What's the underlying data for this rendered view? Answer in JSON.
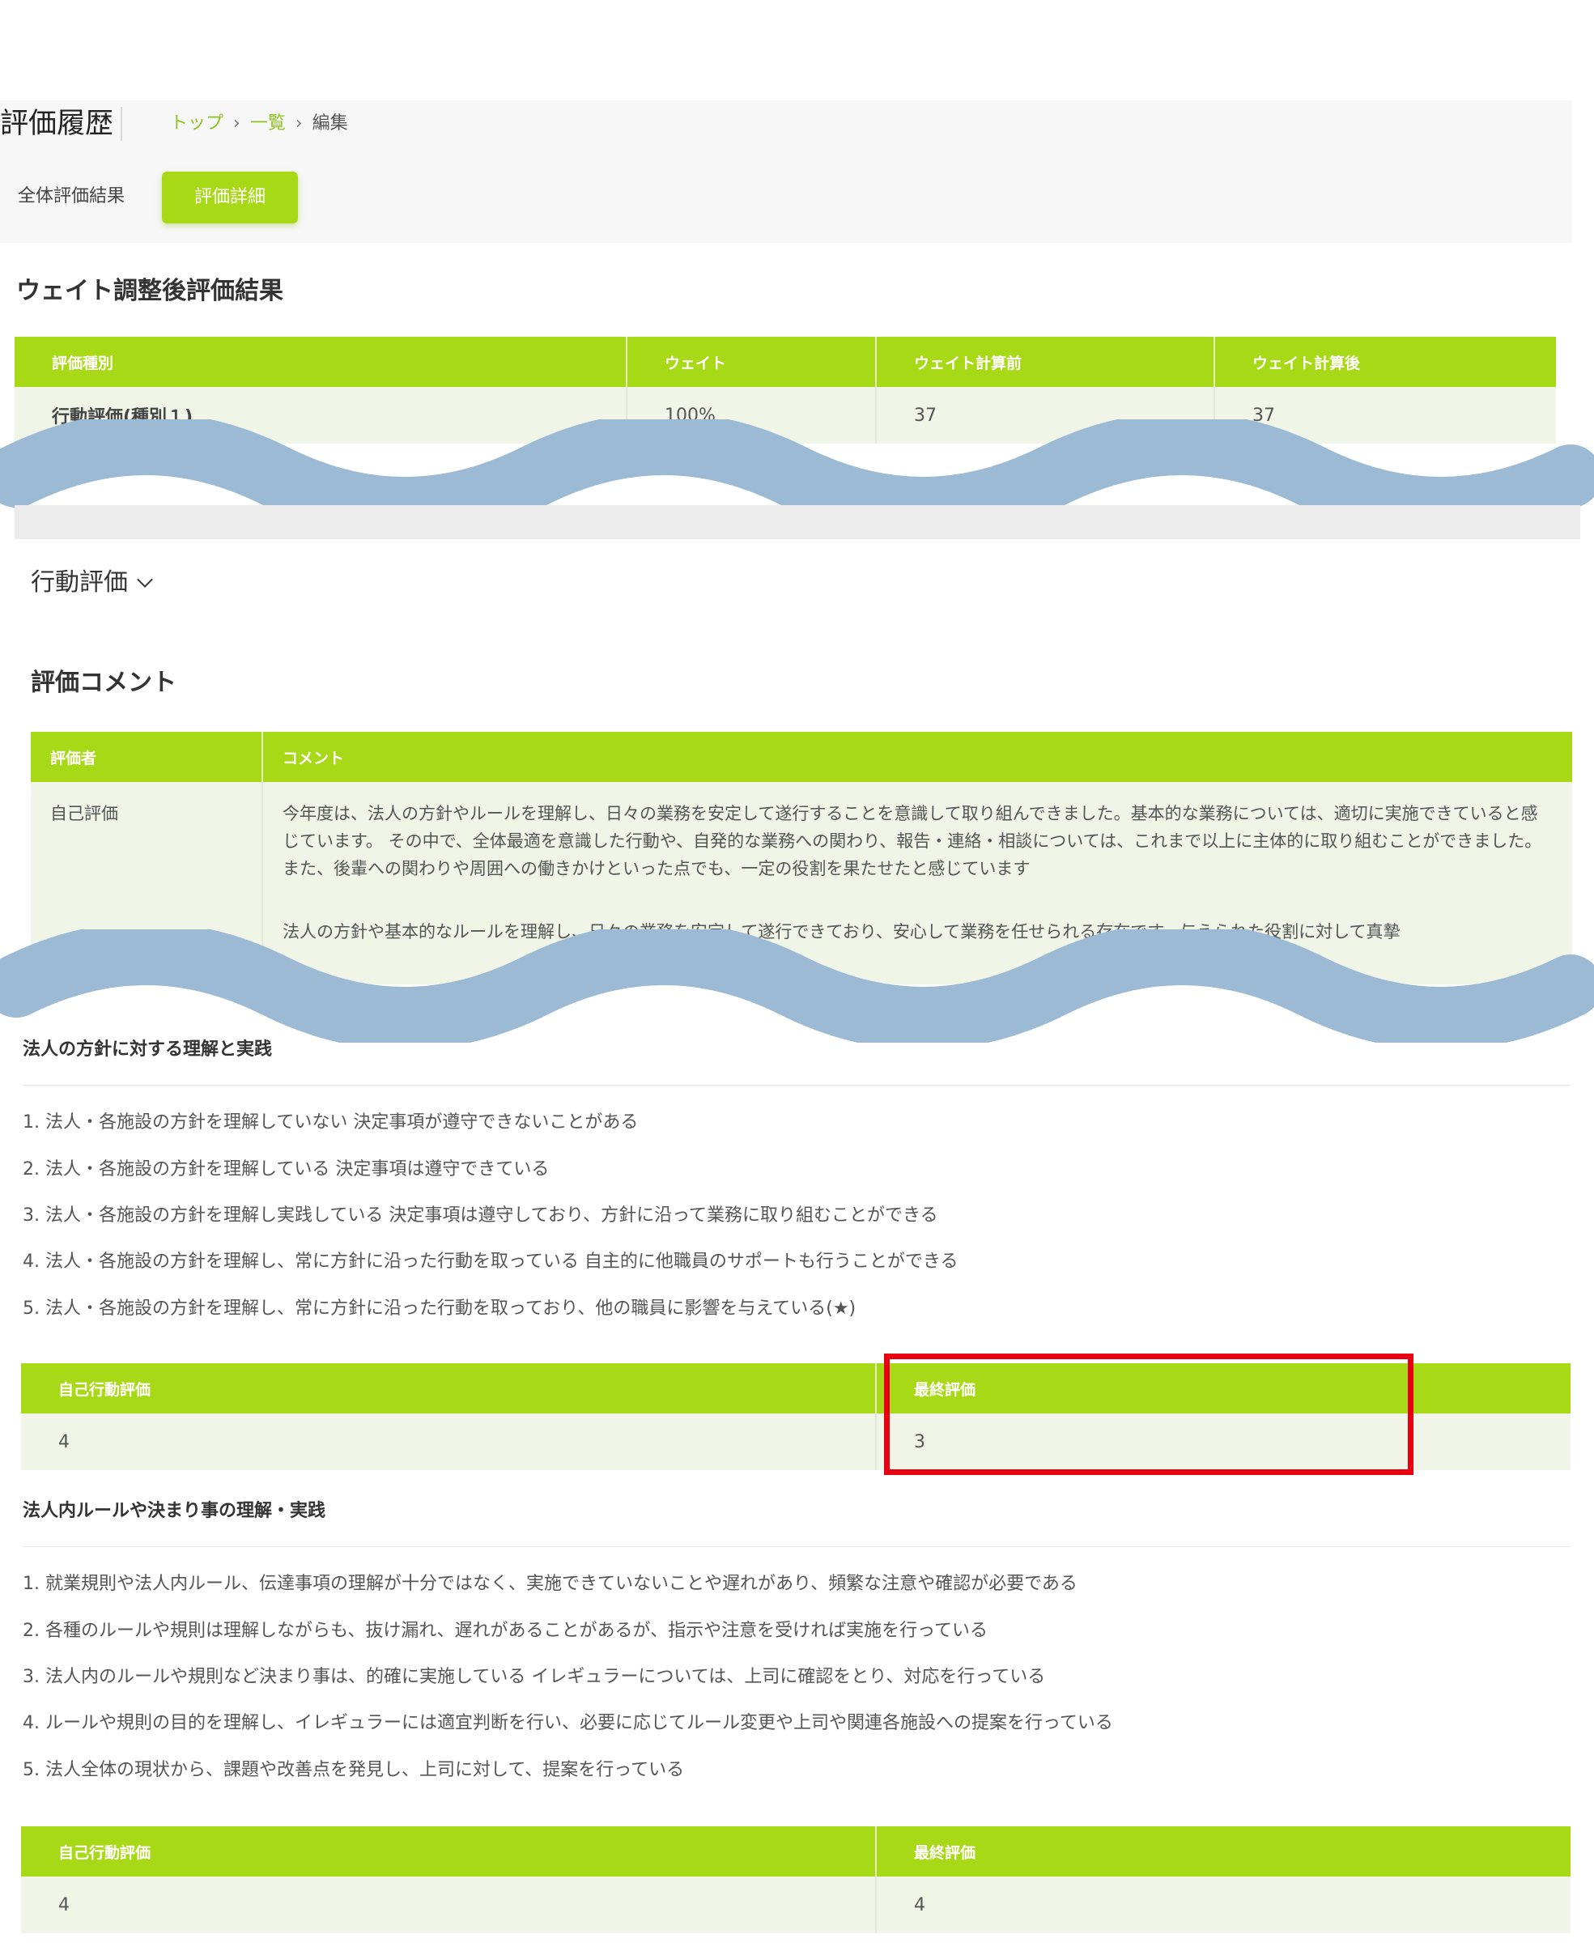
{
  "header": {
    "title": "評価履歴",
    "breadcrumbs": [
      "トップ",
      "一覧",
      "編集"
    ],
    "tabs": [
      {
        "label": "全体評価結果"
      },
      {
        "label": "評価詳細"
      }
    ]
  },
  "weight_section": {
    "title": "ウェイト調整後評価結果",
    "columns": [
      "評価種別",
      "ウェイト",
      "ウェイト計算前",
      "ウェイト計算後"
    ],
    "rows": [
      [
        "行動評価(種別１)",
        "100%",
        "37",
        "37"
      ]
    ]
  },
  "accordion": {
    "label": "行動評価"
  },
  "comments": {
    "title": "評価コメント",
    "columns": [
      "評価者",
      "コメント"
    ],
    "rows": [
      {
        "evaluator": "自己評価",
        "comment": "今年度は、法人の方針やルールを理解し、日々の業務を安定して遂行することを意識して取り組んできました。基本的な業務については、適切に実施できていると感じています。 その中で、全体最適を意識した行動や、自発的な業務への関わり、報告・連絡・相談については、これまで以上に主体的に取り組むことができました。また、後輩への関わりや周囲への働きかけといった点でも、一定の役割を果たせたと感じています"
      },
      {
        "evaluator": "",
        "comment": "法人の方針や基本的なルールを理解し、日々の業務を安定して遂行できており、安心して業務を任せられる存在です。与えられた役割に対して真摯"
      }
    ]
  },
  "criteria": [
    {
      "title": "法人の方針に対する理解と実践",
      "levels": [
        "1. 法人・各施設の方針を理解していない 決定事項が遵守できないことがある",
        "2. 法人・各施設の方針を理解している 決定事項は遵守できている",
        "3. 法人・各施設の方針を理解し実践している 決定事項は遵守しており、方針に沿って業務に取り組むことができる",
        "4. 法人・各施設の方針を理解し、常に方針に沿った行動を取っている 自主的に他職員のサポートも行うことができる",
        "5. 法人・各施設の方針を理解し、常に方針に沿った行動を取っており、他の職員に影響を与えている(★)"
      ],
      "score_columns": [
        "自己行動評価",
        "最終評価"
      ],
      "scores": [
        "4",
        "3"
      ]
    },
    {
      "title": "法人内ルールや決まり事の理解・実践",
      "levels": [
        "1. 就業規則や法人内ルール、伝達事項の理解が十分ではなく、実施できていないことや遅れがあり、頻繁な注意や確認が必要である",
        "2. 各種のルールや規則は理解しながらも、抜け漏れ、遅れがあることがあるが、指示や注意を受ければ実施を行っている",
        "3. 法人内のルールや規則など決まり事は、的確に実施している イレギュラーについては、上司に確認をとり、対応を行っている",
        "4. ルールや規則の目的を理解し、イレギュラーには適宜判断を行い、必要に応じてルール変更や上司や関連各施設への提案を行っている",
        "5. 法人全体の現状から、課題や改善点を発見し、上司に対して、提案を行っている"
      ],
      "score_columns": [
        "自己行動評価",
        "最終評価"
      ],
      "scores": [
        "4",
        "4"
      ]
    }
  ],
  "colors": {
    "accent": "#a8d916",
    "highlight": "#e60012",
    "wave": "#9dbad5"
  }
}
